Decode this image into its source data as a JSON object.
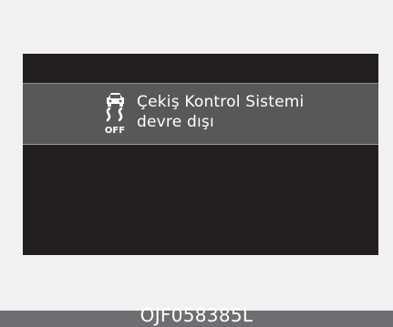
{
  "display": {
    "icon": "traction-control-off-icon",
    "icon_label": "OFF",
    "message_line1": "Çekiş Kontrol Sistemi",
    "message_line2": "devre dışı"
  },
  "footer": {
    "code": "OJF058385L"
  },
  "colors": {
    "page_background": "#f1f1f1",
    "screen_background": "#231f20",
    "message_bar": "#58585a",
    "text": "#ffffff",
    "footer_strip": "#6d6e71"
  }
}
